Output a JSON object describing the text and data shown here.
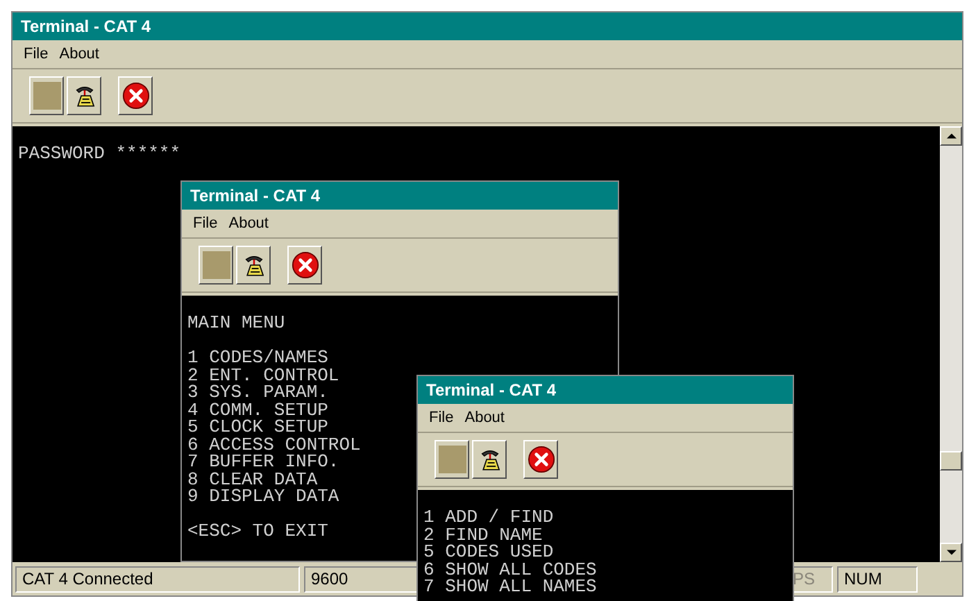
{
  "windows": [
    {
      "title": "Terminal - CAT 4",
      "menu": [
        "File",
        "About"
      ],
      "blocks": [
        [
          "PASSWORD ******"
        ]
      ],
      "scrollbar": true
    },
    {
      "title": "Terminal - CAT 4",
      "menu": [
        "File",
        "About"
      ],
      "blocks": [
        [
          "MAIN MENU"
        ],
        [
          "1 CODES/NAMES",
          "2 ENT. CONTROL",
          "3 SYS. PARAM.",
          "4 COMM. SETUP",
          "5 CLOCK SETUP",
          "6 ACCESS CONTROL",
          "7 BUFFER INFO.",
          "8 CLEAR DATA",
          "9 DISPLAY DATA"
        ],
        [
          "<ESC> TO EXIT"
        ]
      ],
      "scrollbar": false
    },
    {
      "title": "Terminal - CAT 4",
      "menu": [
        "File",
        "About"
      ],
      "blocks": [
        [
          "1 ADD / FIND",
          "2 FIND NAME",
          "5 CODES USED",
          "6 SHOW ALL CODES",
          "7 SHOW ALL NAMES"
        ]
      ],
      "scrollbar": false
    }
  ],
  "status_bar": [
    {
      "text": "CAT 4  Connected",
      "disabled": false
    },
    {
      "text": "9600",
      "disabled": false
    },
    {
      "text": "PS",
      "disabled": true
    },
    {
      "text": "NUM",
      "disabled": false
    }
  ]
}
